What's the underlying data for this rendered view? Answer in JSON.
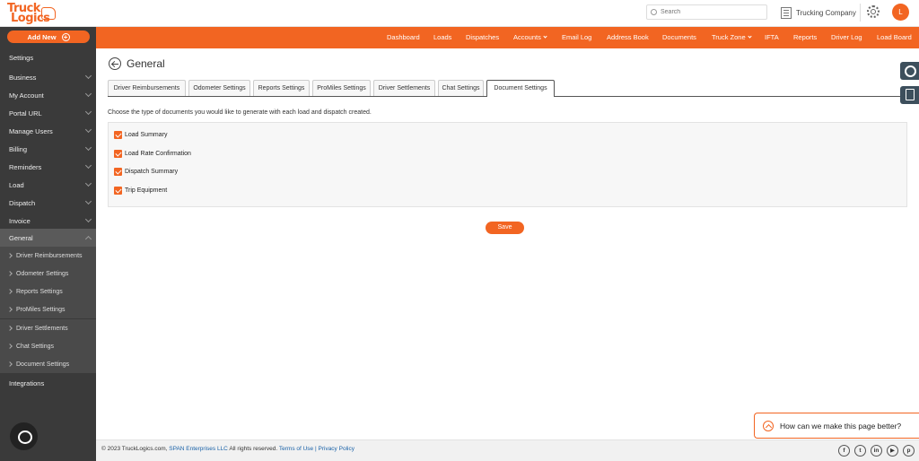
{
  "header": {
    "logo_line1": "Truck",
    "logo_line2": "Logics",
    "search_placeholder": "Search",
    "company_name": "Trucking Company",
    "avatar_initial": "L"
  },
  "sidebar": {
    "add_new_label": "Add New",
    "items": [
      {
        "label": "Settings"
      },
      {
        "label": "Business"
      },
      {
        "label": "My Account"
      },
      {
        "label": "Portal URL"
      },
      {
        "label": "Manage Users"
      },
      {
        "label": "Billing"
      },
      {
        "label": "Reminders"
      },
      {
        "label": "Load"
      },
      {
        "label": "Dispatch"
      },
      {
        "label": "Invoice"
      },
      {
        "label": "General"
      },
      {
        "label": "Integrations"
      }
    ],
    "general_subitems": [
      {
        "label": "Driver Reimbursements"
      },
      {
        "label": "Odometer Settings"
      },
      {
        "label": "Reports Settings"
      },
      {
        "label": "ProMiles Settings"
      },
      {
        "label": "Driver Settlements"
      },
      {
        "label": "Chat Settings"
      },
      {
        "label": "Document Settings"
      }
    ]
  },
  "nav": {
    "items": [
      {
        "label": "Dashboard"
      },
      {
        "label": "Loads"
      },
      {
        "label": "Dispatches"
      },
      {
        "label": "Accounts"
      },
      {
        "label": "Email Log"
      },
      {
        "label": "Address Book"
      },
      {
        "label": "Documents"
      },
      {
        "label": "Truck Zone"
      },
      {
        "label": "IFTA"
      },
      {
        "label": "Reports"
      },
      {
        "label": "Driver Log"
      },
      {
        "label": "Load Board"
      }
    ]
  },
  "page": {
    "title": "General",
    "tabs": [
      {
        "label": "Driver Reimbursements"
      },
      {
        "label": "Odometer Settings"
      },
      {
        "label": "Reports Settings"
      },
      {
        "label": "ProMiles Settings"
      },
      {
        "label": "Driver Settlements"
      },
      {
        "label": "Chat Settings"
      },
      {
        "label": "Document Settings"
      }
    ],
    "active_tab": "Document Settings",
    "description": "Choose the type of documents you would like to generate with each load and dispatch created.",
    "documents": [
      {
        "label": "Load Summary",
        "checked": true
      },
      {
        "label": "Load Rate Confirmation",
        "checked": true
      },
      {
        "label": "Dispatch Summary",
        "checked": true
      },
      {
        "label": "Trip Equipment",
        "checked": true
      }
    ],
    "save_label": "Save"
  },
  "feedback": {
    "label": "How can we make this page better?"
  },
  "footer": {
    "copyright_prefix": "© 2023 TruckLogics.com,",
    "company_link": "SPAN Enterprises LLC",
    "rights": "All rights reserved.",
    "terms": "Terms of Use",
    "divider": "|",
    "privacy": "Privacy Policy",
    "social": [
      {
        "icon": "facebook-icon",
        "glyph": "f"
      },
      {
        "icon": "twitter-icon",
        "glyph": "t"
      },
      {
        "icon": "linkedin-icon",
        "glyph": "in"
      },
      {
        "icon": "youtube-icon",
        "glyph": "▶"
      },
      {
        "icon": "pinterest-icon",
        "glyph": "p"
      }
    ]
  },
  "colors": {
    "brand": "#f26522",
    "sidebar": "#3a3a3a",
    "link": "#1a62a8"
  }
}
